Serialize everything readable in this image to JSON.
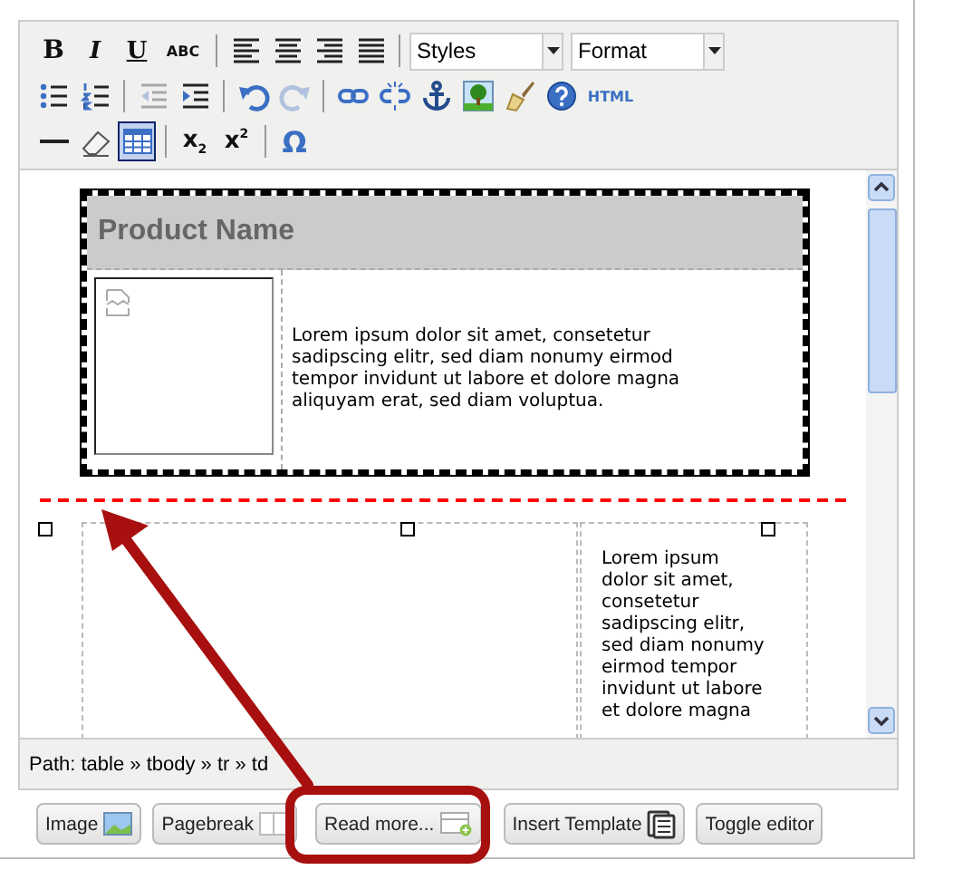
{
  "toolbar": {
    "rows": [
      {
        "groups": [
          {
            "items": [
              {
                "kind": "bold",
                "label": "B",
                "selected": false,
                "disabled": false
              },
              {
                "kind": "italic",
                "label": "I",
                "selected": false,
                "disabled": false
              },
              {
                "kind": "underline",
                "label": "U",
                "selected": false,
                "disabled": false
              },
              {
                "kind": "strike",
                "label": "ABC",
                "selected": false,
                "disabled": false
              }
            ]
          },
          {
            "items": [
              {
                "kind": "align-left",
                "selected": false,
                "disabled": false
              },
              {
                "kind": "align-center",
                "selected": false,
                "disabled": false
              },
              {
                "kind": "align-right",
                "selected": false,
                "disabled": false
              },
              {
                "kind": "justify",
                "selected": false,
                "disabled": false
              }
            ]
          },
          {
            "items": [
              {
                "kind": "dropdown",
                "label": "Styles",
                "selected": false,
                "disabled": false
              },
              {
                "kind": "dropdown",
                "label": "Format",
                "selected": false,
                "disabled": false
              }
            ]
          }
        ]
      },
      {
        "groups": [
          {
            "items": [
              {
                "kind": "bullets",
                "selected": false,
                "disabled": false
              },
              {
                "kind": "numbered",
                "selected": false,
                "disabled": false
              }
            ]
          },
          {
            "items": [
              {
                "kind": "outdent",
                "selected": false,
                "disabled": true
              },
              {
                "kind": "indent",
                "selected": false,
                "disabled": false
              }
            ]
          },
          {
            "items": [
              {
                "kind": "undo",
                "selected": false,
                "disabled": false
              },
              {
                "kind": "redo",
                "selected": false,
                "disabled": true
              }
            ]
          },
          {
            "items": [
              {
                "kind": "link",
                "selected": false,
                "disabled": false
              },
              {
                "kind": "unlink",
                "selected": false,
                "disabled": false
              },
              {
                "kind": "anchor",
                "selected": false,
                "disabled": false
              },
              {
                "kind": "image",
                "selected": false,
                "disabled": false
              },
              {
                "kind": "cleanup",
                "selected": false,
                "disabled": false
              },
              {
                "kind": "help",
                "selected": false,
                "disabled": false
              },
              {
                "kind": "html",
                "label": "HTML",
                "selected": false,
                "disabled": false
              }
            ]
          }
        ]
      },
      {
        "groups": [
          {
            "items": [
              {
                "kind": "rule",
                "selected": false,
                "disabled": false
              },
              {
                "kind": "eraser",
                "selected": false,
                "disabled": false
              },
              {
                "kind": "table",
                "selected": true,
                "disabled": false
              }
            ]
          },
          {
            "items": [
              {
                "kind": "subscript",
                "label": "x$_{2}$",
                "selected": false,
                "disabled": false
              },
              {
                "kind": "superscript",
                "label": "x$^{2}$",
                "selected": false,
                "disabled": false
              }
            ]
          },
          {
            "items": [
              {
                "kind": "omega",
                "label": "Ω",
                "selected": false,
                "disabled": false
              }
            ]
          }
        ]
      }
    ]
  },
  "content": {
    "table_1": {
      "header": "Product Name",
      "text": "Lorem ipsum dolor sit amet, consetetur sadipscing elitr, sed diam nonumy eirmod tempor invidunt ut labore et dolore magna aliquyam erat, sed diam voluptua."
    },
    "table_2": {
      "lines": [
        "Lorem ipsum",
        "dolor sit amet,",
        "consetetur",
        "sadipscing elitr,",
        "sed diam nonumy",
        "eirmod tempor",
        "invidunt ut labore",
        "et dolore magna"
      ]
    }
  },
  "path_bar": "Path: table » tbody » tr » td",
  "buttons": [
    {
      "kind": "image",
      "label": "Image"
    },
    {
      "kind": "pagebreak",
      "label": "Pagebreak"
    },
    {
      "kind": "readmore",
      "label": "Read more..."
    },
    {
      "kind": "template",
      "label": "Insert Template"
    },
    {
      "kind": "toggle",
      "label": "Toggle editor"
    }
  ]
}
